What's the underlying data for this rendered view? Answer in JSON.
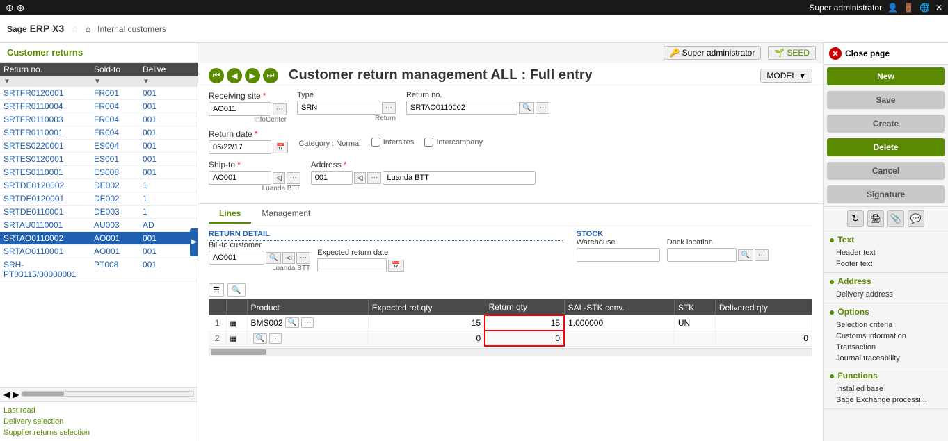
{
  "topbar": {
    "user": "Super administrator",
    "icons": [
      "globe-icon",
      "user-icon",
      "logout-icon",
      "settings-icon",
      "close-icon"
    ]
  },
  "header": {
    "logo": "Sage",
    "logo_erp": " ERP X3",
    "breadcrumb": "Internal customers"
  },
  "sidebar": {
    "title": "Customer returns",
    "columns": [
      "Return no.",
      "Sold-to",
      "Delive"
    ],
    "rows": [
      {
        "return_no": "SRTFR0120001",
        "sold_to": "FR001",
        "delivery": "001"
      },
      {
        "return_no": "SRTFR0110004",
        "sold_to": "FR004",
        "delivery": "001"
      },
      {
        "return_no": "SRTFR0110003",
        "sold_to": "FR004",
        "delivery": "001"
      },
      {
        "return_no": "SRTFR0110001",
        "sold_to": "FR004",
        "delivery": "001"
      },
      {
        "return_no": "SRTES0220001",
        "sold_to": "ES004",
        "delivery": "001"
      },
      {
        "return_no": "SRTES0120001",
        "sold_to": "ES001",
        "delivery": "001"
      },
      {
        "return_no": "SRTES0110001",
        "sold_to": "ES008",
        "delivery": "001"
      },
      {
        "return_no": "SRTDE0120002",
        "sold_to": "DE002",
        "delivery": "1"
      },
      {
        "return_no": "SRTDE0120001",
        "sold_to": "DE002",
        "delivery": "1"
      },
      {
        "return_no": "SRTDE0110001",
        "sold_to": "DE003",
        "delivery": "1"
      },
      {
        "return_no": "SRTAU0110001",
        "sold_to": "AU003",
        "delivery": "AD"
      },
      {
        "return_no": "SRTAO0110002",
        "sold_to": "AO001",
        "delivery": "001",
        "active": true
      },
      {
        "return_no": "SRTAO0110001",
        "sold_to": "AO001",
        "delivery": "001"
      },
      {
        "return_no": "SRH-PT03115/00000001",
        "sold_to": "PT008",
        "delivery": "001"
      }
    ],
    "footer_items": [
      "Last read",
      "Delivery selection",
      "Supplier returns selection"
    ]
  },
  "content": {
    "admin_btn": "Super administrator",
    "seed_btn": "SEED",
    "model_btn": "MODEL",
    "page_title": "Customer return management ALL : Full entry",
    "nav_buttons": [
      "first",
      "prev",
      "next",
      "last"
    ]
  },
  "form": {
    "receiving_site_label": "Receiving site",
    "receiving_site_value": "AO011",
    "receiving_site_sublabel": "InfoCenter",
    "type_label": "Type",
    "type_value": "SRN",
    "type_sublabel": "Return",
    "return_no_label": "Return no.",
    "return_no_value": "SRTAO0110002",
    "return_date_label": "Return date",
    "return_date_value": "06/22/17",
    "category_label": "Category : Normal",
    "intersites_label": "Intersites",
    "intercompany_label": "Intercompany",
    "ship_to_label": "Ship-to",
    "ship_to_value": "AO001",
    "ship_to_sublabel": "Luanda BTT",
    "address_label": "Address",
    "address_code": "001",
    "address_name": "Luanda BTT"
  },
  "tabs": {
    "items": [
      "Lines",
      "Management"
    ],
    "active": "Lines"
  },
  "lines": {
    "return_detail_title": "RETURN DETAIL",
    "stock_title": "STOCK",
    "bill_to_label": "Bill-to customer",
    "bill_to_value": "AO001",
    "bill_to_sublabel": "Luanda BTT",
    "expected_return_date_label": "Expected return date",
    "warehouse_label": "Warehouse",
    "dock_location_label": "Dock location",
    "table_columns": [
      "",
      "Product",
      "Expected ret qty",
      "Return qty",
      "SAL-STK conv.",
      "STK",
      "Delivered qty"
    ],
    "table_rows": [
      {
        "num": "1",
        "has_icon": true,
        "product": "BMS002",
        "expected_ret_qty": "15",
        "return_qty": "15",
        "sal_stk": "1.000000",
        "stk": "UN",
        "delivered_qty": "",
        "highlighted": true
      },
      {
        "num": "2",
        "has_icon": true,
        "product": "",
        "expected_ret_qty": "0",
        "return_qty": "0",
        "sal_stk": "",
        "stk": "",
        "delivered_qty": "0",
        "highlighted": true
      }
    ]
  },
  "right_panel": {
    "close_label": "Close page",
    "buttons": [
      {
        "label": "New",
        "style": "green"
      },
      {
        "label": "Save",
        "style": "gray"
      },
      {
        "label": "Create",
        "style": "gray"
      },
      {
        "label": "Delete",
        "style": "green"
      },
      {
        "label": "Cancel",
        "style": "gray"
      },
      {
        "label": "Signature",
        "style": "gray"
      }
    ],
    "icons": [
      "refresh-icon",
      "print-icon",
      "attachment-icon",
      "chat-icon"
    ],
    "sections": [
      {
        "title": "Text",
        "items": [
          "Header text",
          "Footer text"
        ]
      },
      {
        "title": "Address",
        "items": [
          "Delivery address"
        ]
      },
      {
        "title": "Options",
        "items": [
          "Selection criteria",
          "Customs information",
          "Transaction",
          "Journal traceability"
        ]
      },
      {
        "title": "Functions",
        "items": [
          "Installed base",
          "Sage Exchange processi..."
        ]
      }
    ]
  }
}
